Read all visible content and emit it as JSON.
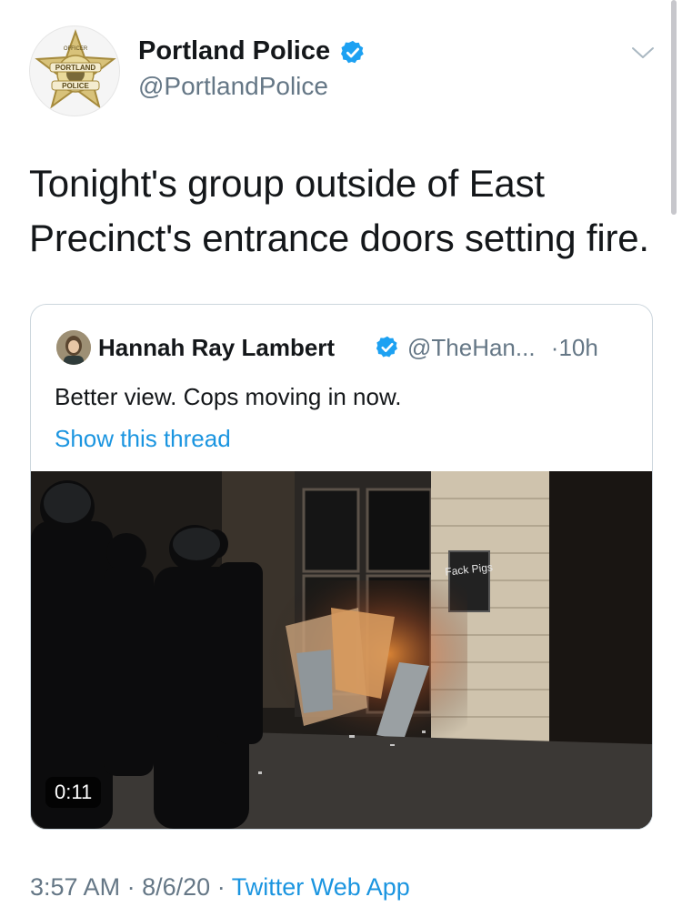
{
  "tweet": {
    "author": {
      "display_name": "Portland Police",
      "handle": "@PortlandPolice",
      "verified": true,
      "avatar_text": {
        "top": "OFFICER",
        "city": "PORTLAND",
        "bottom": "POLICE"
      }
    },
    "text": "Tonight's group outside of East Precinct's entrance doors setting fire.",
    "time": "3:57 AM",
    "separator": "·",
    "date": "8/6/20",
    "source": "Twitter Web App"
  },
  "quoted_tweet": {
    "author": {
      "display_name": "Hannah Ray Lambert",
      "handle": "@TheHan...",
      "verified": true
    },
    "separator": "·",
    "age": "10h",
    "text": "Better view. Cops moving in now.",
    "show_thread": "Show this thread",
    "video": {
      "duration": "0:11",
      "graffiti_text": "Fack Pigs"
    }
  },
  "icons": {
    "verified": "verified-badge-icon",
    "caret": "chevron-down-icon"
  },
  "colors": {
    "text": "#14171a",
    "secondary": "#657786",
    "link": "#1b95e0",
    "verified": "#1da1f2",
    "border": "#ccd6dd"
  }
}
